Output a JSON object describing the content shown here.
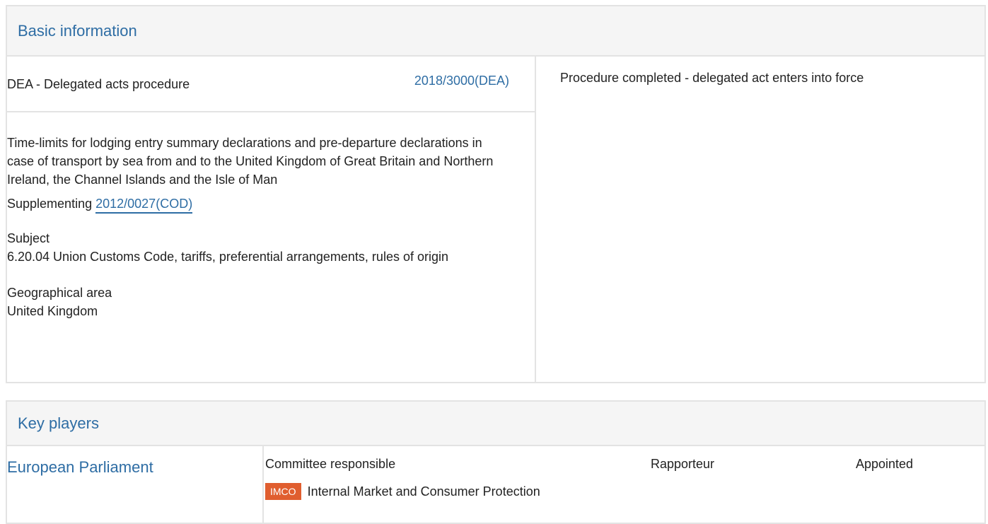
{
  "basic": {
    "header": "Basic information",
    "procedure_type": "DEA - Delegated acts procedure",
    "procedure_ref": "2018/3000(DEA)",
    "status": "Procedure completed - delegated act enters into force",
    "title": "Time-limits for lodging entry summary declarations and pre-departure declarations in case of transport by sea from and to the United Kingdom of Great Britain and Northern Ireland, the Channel Islands and the Isle of Man",
    "supplementing_label": "Supplementing",
    "supplementing_link": "2012/0027(COD)",
    "subject_label": "Subject",
    "subject_value": "6.20.04 Union Customs Code, tariffs, preferential arrangements, rules of origin",
    "geo_label": "Geographical area",
    "geo_value": "United Kingdom"
  },
  "players": {
    "header": "Key players",
    "institution": "European Parliament",
    "col_committee": "Committee responsible",
    "col_rapporteur": "Rapporteur",
    "col_appointed": "Appointed",
    "committee_code": "IMCO",
    "committee_name": "Internal Market and Consumer Protection",
    "badge_color": "#e05e2f"
  }
}
